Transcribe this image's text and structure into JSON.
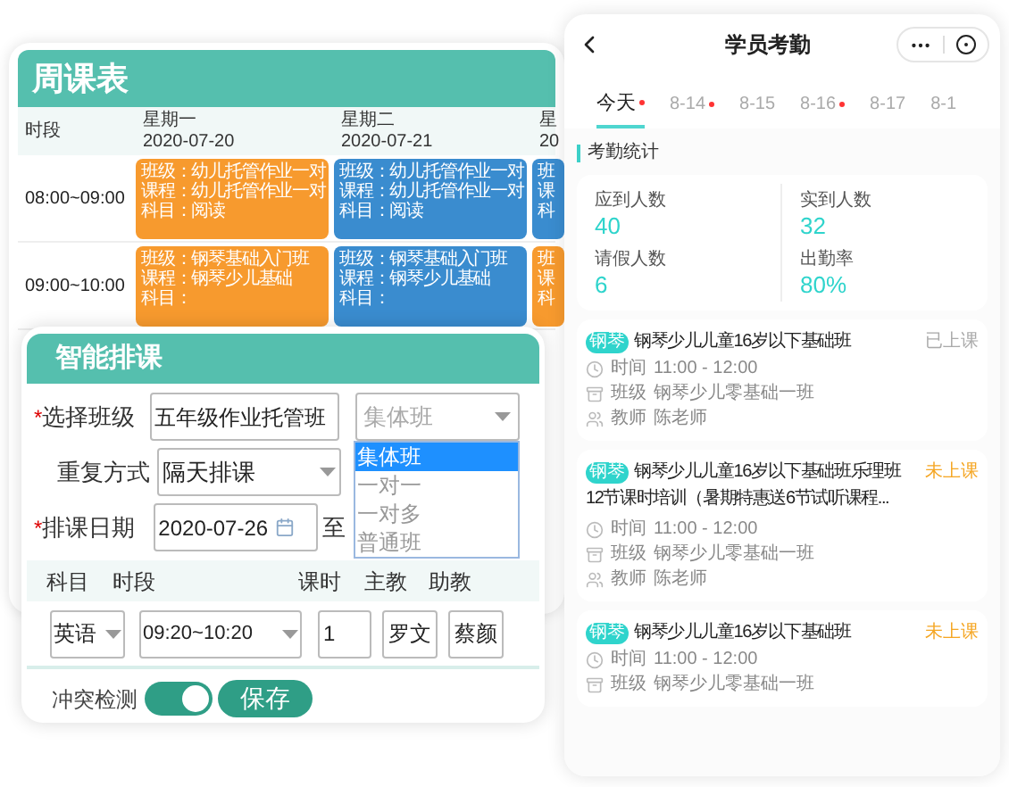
{
  "schedule": {
    "title": "周课表",
    "time_header": "时段",
    "days": [
      {
        "weekday": "星期一",
        "date": "2020-07-20"
      },
      {
        "weekday": "星期二",
        "date": "2020-07-21"
      },
      {
        "weekday": "星",
        "date": "20"
      }
    ],
    "rows": [
      {
        "time": "08:00~09:00",
        "cells": [
          {
            "color": "#f79a2e",
            "lines": [
              "班级：幼儿托管作业一对",
              "课程：幼儿托管作业一对",
              "科目：阅读"
            ]
          },
          {
            "color": "#3a8ccf",
            "lines": [
              "班级：幼儿托管作业一对",
              "课程：幼儿托管作业一对",
              "科目：阅读"
            ]
          },
          {
            "color": "#3a8ccf",
            "lines": [
              "班",
              "课",
              "科"
            ]
          }
        ]
      },
      {
        "time": "09:00~10:00",
        "cells": [
          {
            "color": "#f79a2e",
            "lines": [
              "班级：钢琴基础入门班",
              "课程：钢琴少儿基础",
              "科目："
            ]
          },
          {
            "color": "#3a8ccf",
            "lines": [
              "班级：钢琴基础入门班",
              "课程：钢琴少儿基础",
              "科目："
            ]
          },
          {
            "color": "#f79a2e",
            "lines": [
              "班",
              "课",
              "科"
            ]
          }
        ]
      }
    ]
  },
  "scheduler": {
    "title": "智能排课",
    "class_field": {
      "mark": "*",
      "label": "选择班级",
      "value": "五年级作业托管班"
    },
    "type_select": {
      "placeholder": "集体班",
      "options": [
        {
          "label": "集体班",
          "selected": true
        },
        {
          "label": "一对一",
          "selected": false
        },
        {
          "label": "一对多",
          "selected": false
        },
        {
          "label": "普通班",
          "selected": false
        }
      ]
    },
    "repeat": {
      "label": "重复方式",
      "value": "隔天排课"
    },
    "date": {
      "mark": "*",
      "label": "排课日期",
      "value": "2020-07-26",
      "to": "至"
    },
    "columns": [
      "科目",
      "时段",
      "课时",
      "主教",
      "助教"
    ],
    "row": {
      "subject": "英语",
      "period": "09:20~10:20",
      "hours": "1",
      "teacher": "罗文",
      "assistant": "蔡颜"
    },
    "conflict": {
      "label": "冲突检测",
      "on": true
    },
    "save": "保存"
  },
  "attendance": {
    "title": "学员考勤",
    "tabs": [
      {
        "label": "今天",
        "dot": true,
        "selected": true
      },
      {
        "label": "8-14",
        "dot": true,
        "selected": false
      },
      {
        "label": "8-15",
        "dot": false,
        "selected": false
      },
      {
        "label": "8-16",
        "dot": true,
        "selected": false
      },
      {
        "label": "8-17",
        "dot": false,
        "selected": false
      },
      {
        "label": "8-1",
        "dot": false,
        "selected": false
      }
    ],
    "section": "考勤统计",
    "stats": [
      {
        "label": "应到人数",
        "value": "40"
      },
      {
        "label": "实到人数",
        "value": "32"
      },
      {
        "label": "请假人数",
        "value": "6"
      },
      {
        "label": "出勤率",
        "value": "80%"
      }
    ],
    "lessons": [
      {
        "tag": "钢琴",
        "title": [
          "钢琴少儿儿童16岁以下基础班"
        ],
        "status": "已上课",
        "color": "#aaaaaa",
        "details": [
          {
            "kind": "time",
            "label": "时间",
            "value": "11:00 - 12:00"
          },
          {
            "kind": "class",
            "label": "班级",
            "value": "钢琴少儿零基础一班"
          },
          {
            "kind": "teacher",
            "label": "教师",
            "value": "陈老师"
          }
        ]
      },
      {
        "tag": "钢琴",
        "title": [
          "钢琴少儿儿童16岁以下基础班乐理班",
          "12节课时培训（暑期特惠送6节试听课程..."
        ],
        "status": "未上课",
        "color": "#f5a623",
        "details": [
          {
            "kind": "time",
            "label": "时间",
            "value": "11:00 - 12:00"
          },
          {
            "kind": "class",
            "label": "班级",
            "value": "钢琴少儿零基础一班"
          },
          {
            "kind": "teacher",
            "label": "教师",
            "value": "陈老师"
          }
        ]
      },
      {
        "tag": "钢琴",
        "title": [
          "钢琴少儿儿童16岁以下基础班"
        ],
        "status": "未上课",
        "color": "#f5a623",
        "details": [
          {
            "kind": "time",
            "label": "时间",
            "value": "11:00 - 12:00"
          },
          {
            "kind": "class",
            "label": "班级",
            "value": "钢琴少儿零基础一班"
          }
        ]
      }
    ]
  }
}
